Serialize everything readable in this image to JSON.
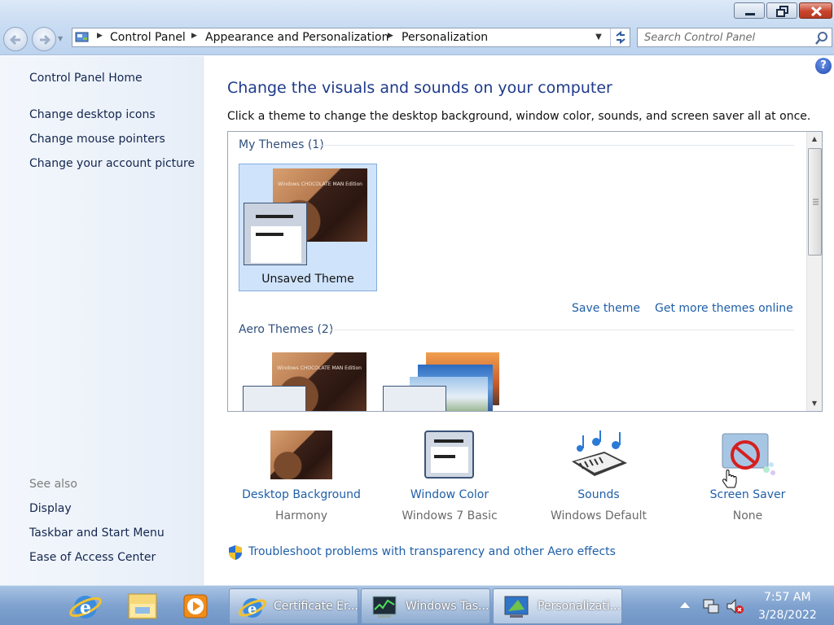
{
  "window": {
    "breadcrumbs": [
      "Control Panel",
      "Appearance and Personalization",
      "Personalization"
    ],
    "search_placeholder": "Search Control Panel"
  },
  "sidebar": {
    "home": "Control Panel Home",
    "tasks": [
      "Change desktop icons",
      "Change mouse pointers",
      "Change your account picture"
    ],
    "see_also_label": "See also",
    "see_also": [
      "Display",
      "Taskbar and Start Menu",
      "Ease of Access Center"
    ]
  },
  "main": {
    "title": "Change the visuals and sounds on your computer",
    "description": "Click a theme to change the desktop background, window color, sounds, and screen saver all at once.",
    "groups": {
      "my_themes": "My Themes (1)",
      "aero_themes": "Aero Themes (2)"
    },
    "unsaved_theme_label": "Unsaved Theme",
    "choc_caption": "Windows CHOCOLATE MAN Edition",
    "save_theme": "Save theme",
    "get_more_themes": "Get more themes online",
    "settings": [
      {
        "title": "Desktop Background",
        "value": "Harmony"
      },
      {
        "title": "Window Color",
        "value": "Windows 7 Basic"
      },
      {
        "title": "Sounds",
        "value": "Windows Default"
      },
      {
        "title": "Screen Saver",
        "value": "None"
      }
    ],
    "troubleshoot": "Troubleshoot problems with transparency and other Aero effects"
  },
  "taskbar": {
    "tasks": [
      {
        "label": "Certificate Er...",
        "icon": "internet-explorer-icon"
      },
      {
        "label": "Windows Tas...",
        "icon": "task-manager-icon"
      },
      {
        "label": "Personalizati...",
        "icon": "personalization-icon"
      }
    ],
    "pinned": [
      "internet-explorer-icon",
      "windows-explorer-icon",
      "media-player-icon"
    ],
    "time": "7:57 AM",
    "date": "3/28/2022"
  },
  "colors": {
    "link": "#1f5fa8",
    "title": "#1e3a8a",
    "sidebar_bg": "#e7eef8",
    "selection": "#cfe3fb"
  }
}
